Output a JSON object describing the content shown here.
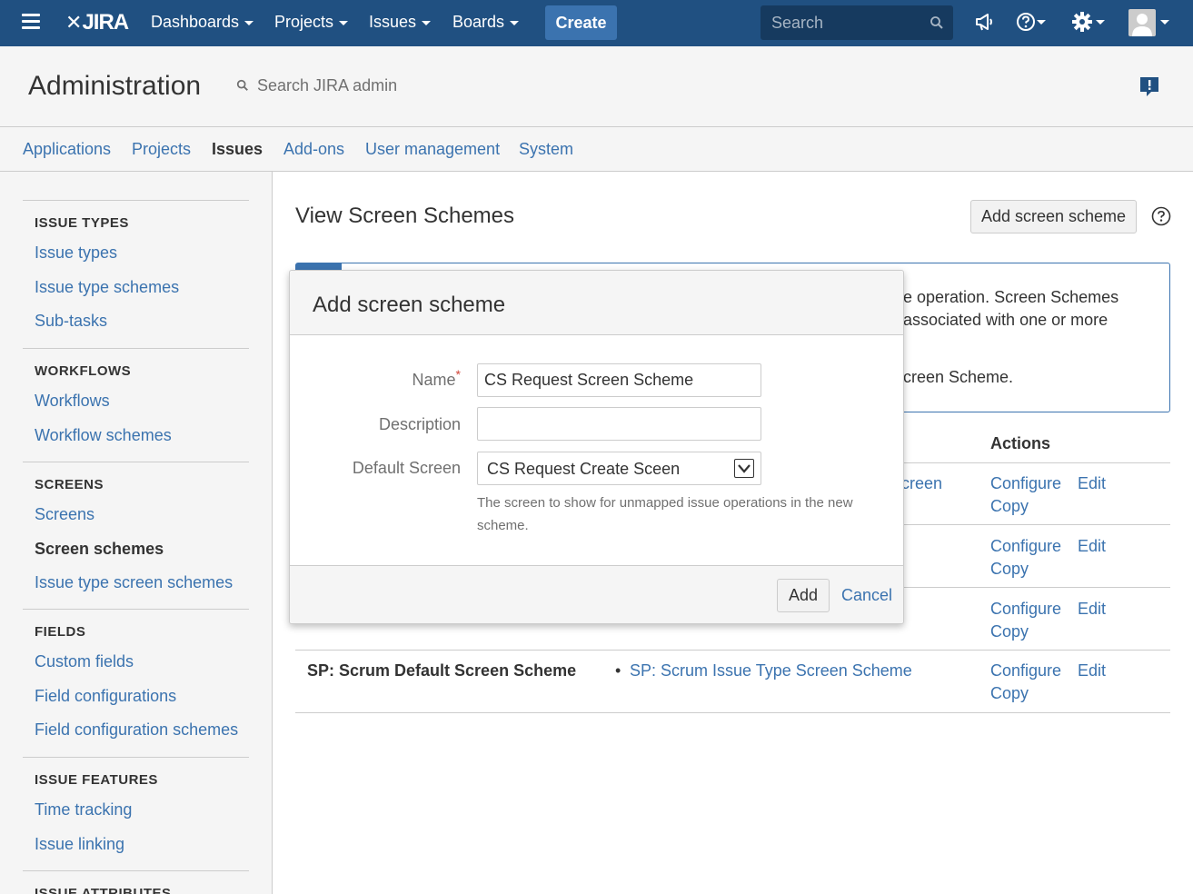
{
  "topnav": {
    "logo_text": "JIRA",
    "items": [
      "Dashboards",
      "Projects",
      "Issues",
      "Boards"
    ],
    "create_label": "Create",
    "search_placeholder": "Search"
  },
  "admin": {
    "title": "Administration",
    "search_placeholder": "Search JIRA admin",
    "tabs": [
      "Applications",
      "Projects",
      "Issues",
      "Add-ons",
      "User management",
      "System"
    ],
    "active_tab": "Issues"
  },
  "sidebar": {
    "sections": [
      {
        "heading": "ISSUE TYPES",
        "items": [
          "Issue types",
          "Issue type schemes",
          "Sub-tasks"
        ]
      },
      {
        "heading": "WORKFLOWS",
        "items": [
          "Workflows",
          "Workflow schemes"
        ]
      },
      {
        "heading": "SCREENS",
        "items": [
          "Screens",
          "Screen schemes",
          "Issue type screen schemes"
        ]
      },
      {
        "heading": "FIELDS",
        "items": [
          "Custom fields",
          "Field configurations",
          "Field configuration schemes"
        ]
      },
      {
        "heading": "ISSUE FEATURES",
        "items": [
          "Time tracking",
          "Issue linking"
        ]
      },
      {
        "heading": "ISSUE ATTRIBUTES",
        "items": []
      }
    ],
    "active_item": "Screen schemes"
  },
  "main": {
    "title": "View Screen Schemes",
    "add_button": "Add screen scheme",
    "info_lines": [
      "e operation. Screen Schemes",
      " associated with one or more",
      "creen Scheme."
    ],
    "actions_header": "Actions",
    "row1_fragment": "creen",
    "last_row": {
      "name": "SP: Scrum Default Screen Scheme",
      "link": "SP: Scrum Issue Type Screen Scheme"
    },
    "action_labels": {
      "configure": "Configure",
      "edit": "Edit",
      "copy": "Copy"
    }
  },
  "dialog": {
    "title": "Add screen scheme",
    "name_label": "Name",
    "required_mark": "*",
    "name_value": "CS Request Screen Scheme",
    "description_label": "Description",
    "description_value": "",
    "default_screen_label": "Default Screen",
    "default_screen_value": "CS Request Create Sceen",
    "help_text": "The screen to show for unmapped issue operations in the new scheme.",
    "add_label": "Add",
    "cancel_label": "Cancel"
  },
  "colors": {
    "nav_bg": "#205081",
    "link": "#3b73af",
    "create_btn": "#3b73af"
  }
}
